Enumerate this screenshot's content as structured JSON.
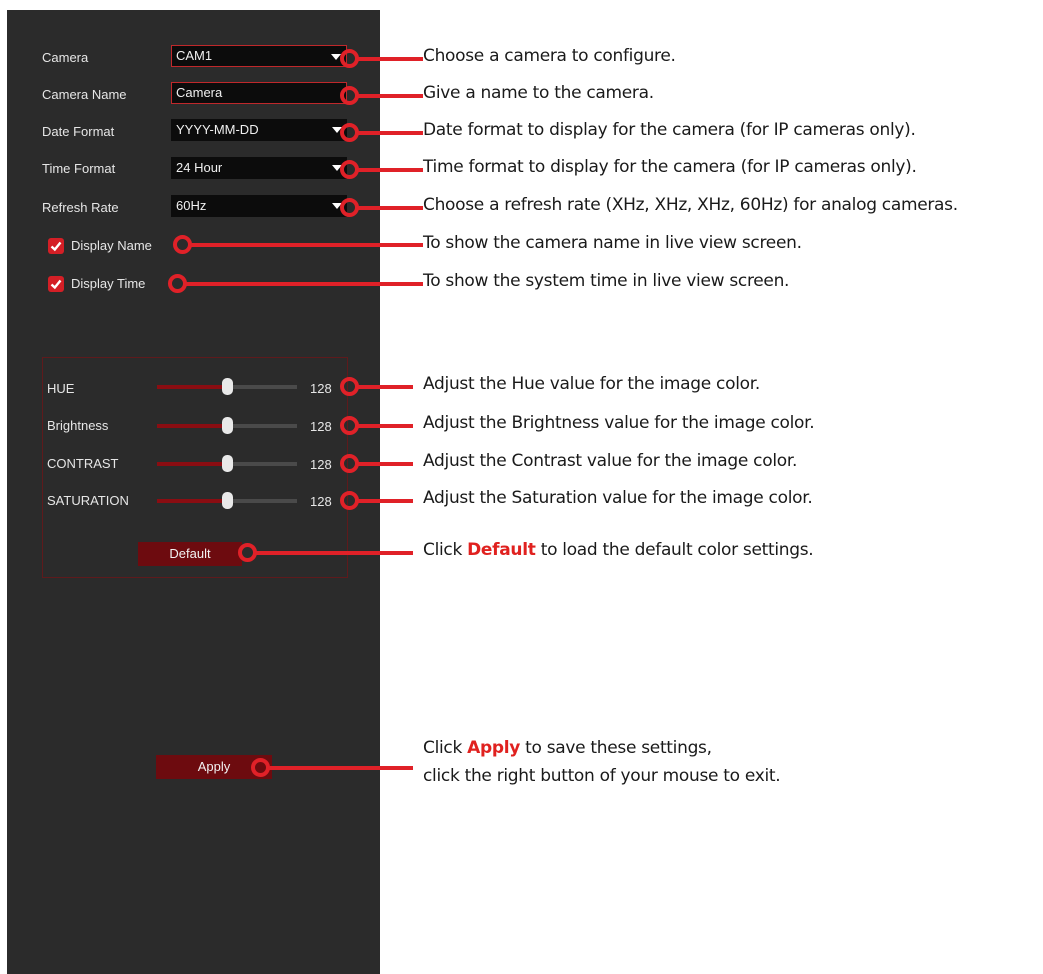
{
  "settings": {
    "camera": {
      "label": "Camera",
      "value": "CAM1"
    },
    "camera_name": {
      "label": "Camera Name",
      "value": "Camera"
    },
    "date_format": {
      "label": "Date Format",
      "value": "YYYY-MM-DD"
    },
    "time_format": {
      "label": "Time Format",
      "value": "24 Hour"
    },
    "refresh_rate": {
      "label": "Refresh Rate",
      "value": "60Hz"
    },
    "display_name": {
      "label": "Display Name",
      "checked": true
    },
    "display_time": {
      "label": "Display Time",
      "checked": true
    }
  },
  "color": {
    "hue": {
      "label": "HUE",
      "value": "128",
      "level": 0.5
    },
    "brightness": {
      "label": "Brightness",
      "value": "128",
      "level": 0.5
    },
    "contrast": {
      "label": "CONTRAST",
      "value": "128",
      "level": 0.5
    },
    "saturation": {
      "label": "SATURATION",
      "value": "128",
      "level": 0.5
    },
    "default_label": "Default"
  },
  "apply_label": "Apply",
  "annotations": {
    "camera": "Choose a camera to configure.",
    "camera_name": "Give a name to the camera.",
    "date_format": "Date format to display for the camera (for IP cameras only).",
    "time_format": "Time format to display for the camera (for IP cameras only).",
    "refresh_rate": "Choose a refresh rate (XHz, XHz, XHz, 60Hz) for analog cameras.",
    "display_name": "To show the camera name in live view screen.",
    "display_time": "To show the system time in live view screen.",
    "hue": "Adjust the Hue value for the image color.",
    "brightness": "Adjust the Brightness value for the image color.",
    "contrast": "Adjust the Contrast value for the image color.",
    "saturation": "Adjust the Saturation value for the image color.",
    "default_pre": "Click ",
    "default_bold": "Default",
    "default_post": " to load the default color settings.",
    "apply_pre": "Click ",
    "apply_bold": "Apply",
    "apply_post": " to save these settings,",
    "apply_line2": "click the right button of your mouse to exit."
  },
  "colors": {
    "accent": "#e02128",
    "panel": "#2b2b2b",
    "button": "#6d0b0f"
  }
}
